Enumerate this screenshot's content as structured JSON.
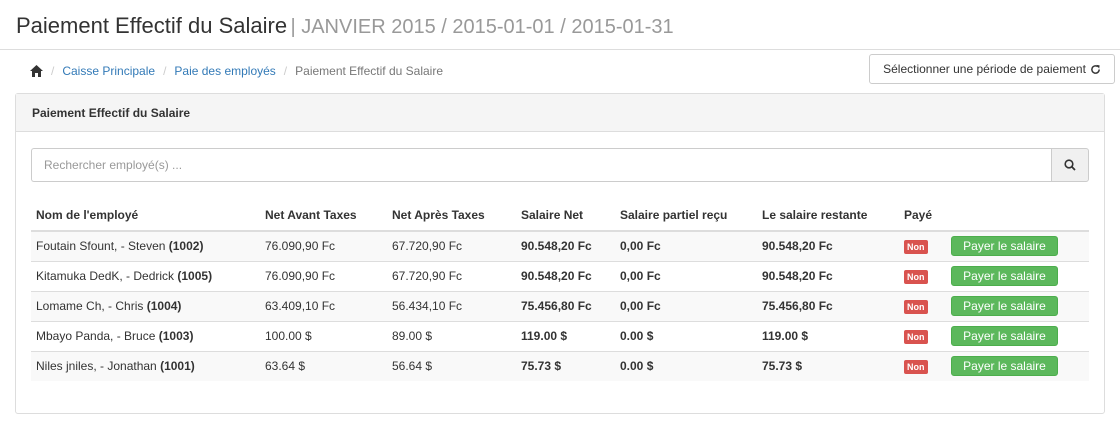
{
  "header": {
    "title": "Paiement Effectif du Salaire",
    "subtitle": "| JANVIER 2015 / 2015-01-01 / 2015-01-31"
  },
  "breadcrumb": {
    "items": [
      "Caisse Principale",
      "Paie des employés"
    ],
    "active": "Paiement Effectif du Salaire",
    "separator": "/"
  },
  "period_button": {
    "label": "Sélectionner une période de paiement"
  },
  "panel": {
    "heading": "Paiement Effectif du Salaire",
    "search_placeholder": "Rechercher employé(s) ..."
  },
  "table": {
    "columns": [
      "Nom de l'employé",
      "Net Avant Taxes",
      "Net Après Taxes",
      "Salaire Net",
      "Salaire partiel reçu",
      "Le salaire restante",
      "Payé",
      ""
    ],
    "rows": [
      {
        "name": "Foutain Sfount, - Steven",
        "id": "(1002)",
        "net_avant": "76.090,90 Fc",
        "net_apres": "67.720,90 Fc",
        "salaire_net": "90.548,20 Fc",
        "partiel": "0,00 Fc",
        "restante": "90.548,20 Fc",
        "paye": "Non",
        "action": "Payer le salaire"
      },
      {
        "name": "Kitamuka DedK, - Dedrick",
        "id": "(1005)",
        "net_avant": "76.090,90 Fc",
        "net_apres": "67.720,90 Fc",
        "salaire_net": "90.548,20 Fc",
        "partiel": "0,00 Fc",
        "restante": "90.548,20 Fc",
        "paye": "Non",
        "action": "Payer le salaire"
      },
      {
        "name": "Lomame Ch, - Chris",
        "id": "(1004)",
        "net_avant": "63.409,10 Fc",
        "net_apres": "56.434,10 Fc",
        "salaire_net": "75.456,80 Fc",
        "partiel": "0,00 Fc",
        "restante": "75.456,80 Fc",
        "paye": "Non",
        "action": "Payer le salaire"
      },
      {
        "name": "Mbayo Panda, - Bruce",
        "id": "(1003)",
        "net_avant": "100.00 $",
        "net_apres": "89.00 $",
        "salaire_net": "119.00 $",
        "partiel": "0.00 $",
        "restante": "119.00 $",
        "paye": "Non",
        "action": "Payer le salaire"
      },
      {
        "name": "Niles jniles, - Jonathan",
        "id": "(1001)",
        "net_avant": "63.64 $",
        "net_apres": "56.64 $",
        "salaire_net": "75.73 $",
        "partiel": "0.00 $",
        "restante": "75.73 $",
        "paye": "Non",
        "action": "Payer le salaire"
      }
    ]
  },
  "icons": {
    "home": "home-icon",
    "refresh": "refresh-icon",
    "search": "search-icon"
  },
  "colors": {
    "link": "#337ab7",
    "danger": "#d9534f",
    "success": "#5cb85c"
  }
}
